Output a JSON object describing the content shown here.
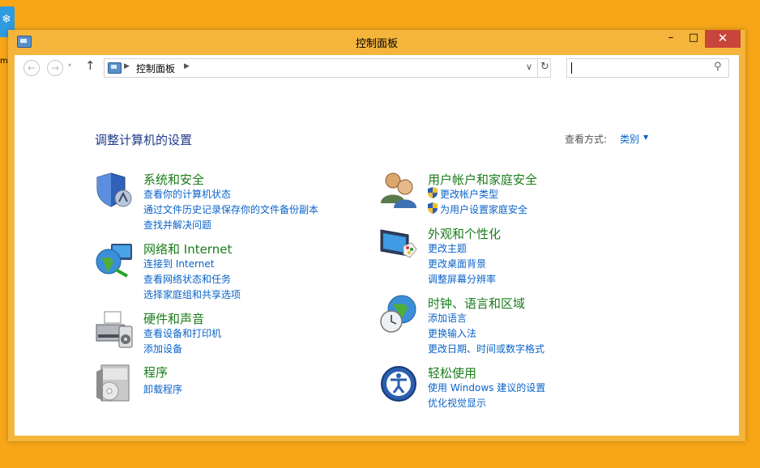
{
  "desktop": {
    "icon_label": "m"
  },
  "window": {
    "title": "控制面板",
    "buttons": {
      "minimize": "–",
      "maximize": "□",
      "close": "✕"
    }
  },
  "nav": {
    "back": "←",
    "forward": "→",
    "recent": "▾",
    "up": "↑",
    "breadcrumb": "控制面板",
    "address_dropdown": "∨",
    "refresh": "↻"
  },
  "search": {
    "value": "",
    "icon": "search-icon"
  },
  "header": {
    "title": "调整计算机的设置",
    "view_by_label": "查看方式:",
    "view_by_value": "类别"
  },
  "categories": [
    {
      "title": "系统和安全",
      "icon": "shield-icon",
      "links": [
        "查看你的计算机状态",
        "通过文件历史记录保存你的文件备份副本",
        "查找并解决问题"
      ]
    },
    {
      "title": "网络和 Internet",
      "icon": "globe-network-icon",
      "links": [
        "连接到 Internet",
        "查看网络状态和任务",
        "选择家庭组和共享选项"
      ]
    },
    {
      "title": "硬件和声音",
      "icon": "printer-icon",
      "links": [
        "查看设备和打印机",
        "添加设备"
      ]
    },
    {
      "title": "程序",
      "icon": "programs-icon",
      "links": [
        "卸载程序"
      ]
    },
    {
      "title": "用户帐户和家庭安全",
      "icon": "users-icon",
      "links": [
        "更改帐户类型",
        "为用户设置家庭安全"
      ]
    },
    {
      "title": "外观和个性化",
      "icon": "monitor-palette-icon",
      "links": [
        "更改主题",
        "更改桌面背景",
        "调整屏幕分辨率"
      ]
    },
    {
      "title": "时钟、语言和区域",
      "icon": "clock-globe-icon",
      "links": [
        "添加语言",
        "更换输入法",
        "更改日期、时间或数字格式"
      ]
    },
    {
      "title": "轻松使用",
      "icon": "ease-of-access-icon",
      "links": [
        "使用 Windows 建议的设置",
        "优化视觉显示"
      ]
    }
  ],
  "colors": {
    "desktop": "#f7a618",
    "window_frame": "#f5b53c",
    "close_button": "#c7453a",
    "category_title": "#1a7c1a",
    "link": "#0a63c9",
    "heading": "#1e3a8a"
  }
}
